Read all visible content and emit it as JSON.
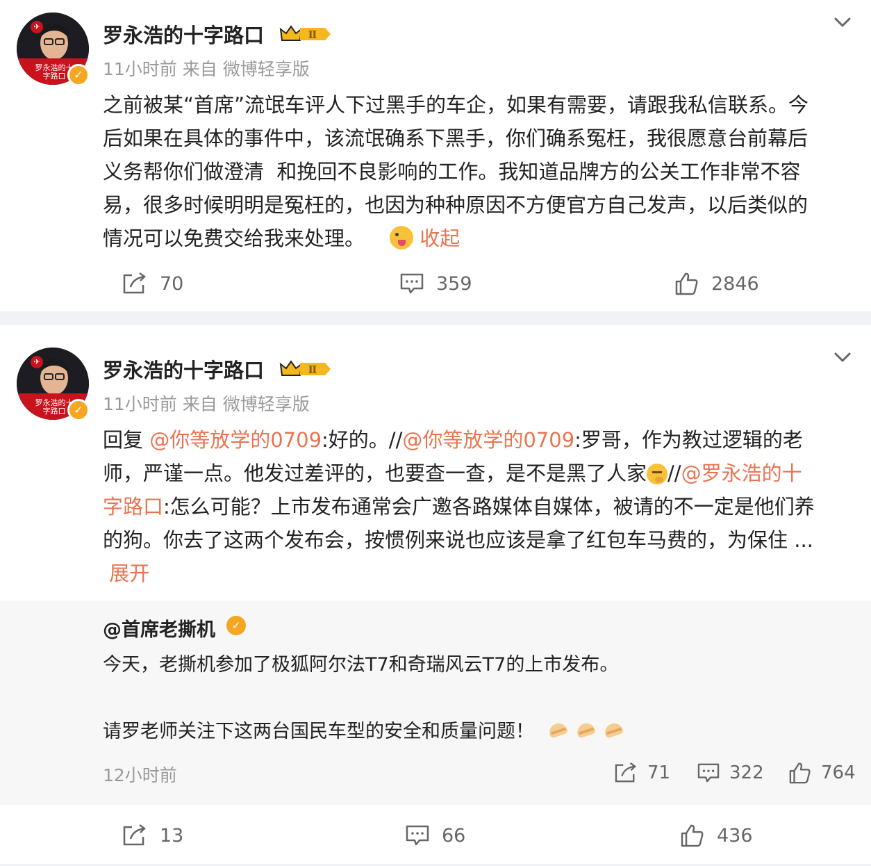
{
  "colors": {
    "accent": "#eb7350",
    "separator": "#f1f2f5",
    "muted": "#999999",
    "verify": "#f5a623"
  },
  "posts": [
    {
      "author": "罗永浩的十字路口",
      "badge": "Ⅱ",
      "avatar_text": "罗永浩的十字路口",
      "time": "11小时前",
      "source": "来自 微博轻享版",
      "lines": [
        "之前被某“首席”流氓车评人下过黑手的车企，如果有需要，请跟我私信联系。今",
        "后如果在具体的事件中，该流氓确系下黑手，你们确系冤枉，我很愿意台前幕后",
        "义务帮你们做澄清  和挽回不良影响的工作。我知道品牌方的公关工作非常不容",
        "易，很多时候明明是冤枉的，也因为种种原因不方便官方自己发声，以后类似的",
        "情况可以免费交给我来处理。"
      ],
      "collapse_label": "收起",
      "emoji_icon": "tongue-emoji-icon",
      "actions": {
        "repost": "70",
        "comment": "359",
        "like": "2846"
      }
    },
    {
      "author": "罗永浩的十字路口",
      "badge": "Ⅱ",
      "avatar_text": "罗永浩的十字路口",
      "time": "11小时前",
      "source": "来自 微博轻享版",
      "reply_prefix": "回复 ",
      "mention_1": "@你等放学的0709",
      "seg_1": ":好的。//",
      "mention_2": "@你等放学的0709",
      "seg_2": ":罗哥，作为教过逻辑的老",
      "line_2": "师，严谨一点。他发过差评的，也要查一查，是不是黑了人家",
      "line_2_sep": "//",
      "mention_3a": "@罗永浩的十",
      "mention_3b": "字路口",
      "line_3": ":怎么可能？上市发布通常会广邀各路媒体自媒体，被请的不一定是他们养",
      "line_4": "的狗。你去了这两个发布会，按惯例来说也应该是拿了红包车马费的，为保住 ...",
      "expand_label": "展开",
      "quote": {
        "author": "@首席老撕机",
        "line_1": "今天，老撕机参加了极狐阿尔法T7和奇瑞风云T7的上市发布。",
        "line_2": "请罗老师关注下这两台国民车型的安全和质量问题！",
        "time": "12小时前",
        "actions": {
          "repost": "71",
          "comment": "322",
          "like": "764"
        }
      },
      "actions": {
        "repost": "13",
        "comment": "66",
        "like": "436"
      }
    }
  ]
}
